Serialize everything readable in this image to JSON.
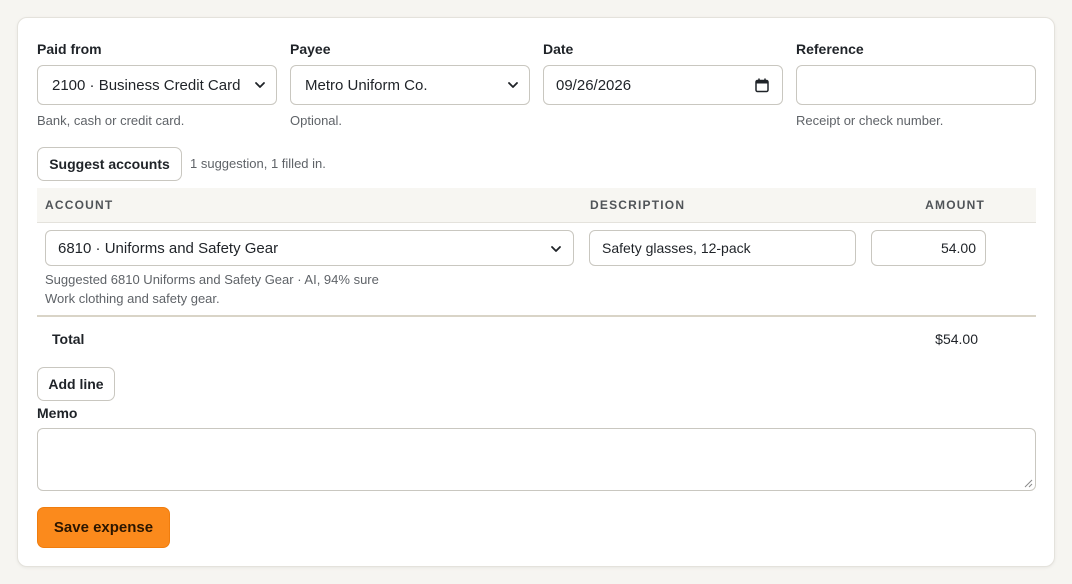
{
  "form": {
    "paid_from": {
      "label": "Paid from",
      "value": "2100 · Business Credit Card",
      "help": "Bank, cash or credit card."
    },
    "payee": {
      "label": "Payee",
      "value": "Metro Uniform Co.",
      "help": "Optional."
    },
    "date": {
      "label": "Date",
      "value": "09/26/2026"
    },
    "reference": {
      "label": "Reference",
      "value": "",
      "help": "Receipt or check number."
    }
  },
  "suggest": {
    "button_label": "Suggest accounts",
    "status": "1 suggestion, 1 filled in."
  },
  "table": {
    "headers": {
      "account": "ACCOUNT",
      "description": "DESCRIPTION",
      "amount": "AMOUNT"
    },
    "rows": [
      {
        "account": "6810 · Uniforms and Safety Gear",
        "description": "Safety glasses, 12-pack",
        "amount": "54.00",
        "suggestion": "Suggested 6810 Uniforms and Safety Gear · AI, 94% sure",
        "account_note": "Work clothing and safety gear."
      }
    ],
    "total_label": "Total",
    "total_value": "$54.00"
  },
  "add_line_label": "Add line",
  "memo": {
    "label": "Memo",
    "value": ""
  },
  "save_label": "Save expense",
  "colors": {
    "accent": "#fb8a1c",
    "background": "#f6f5f1"
  },
  "icons": {
    "select_arrow": "chevron-down-icon",
    "calendar": "calendar-icon"
  }
}
